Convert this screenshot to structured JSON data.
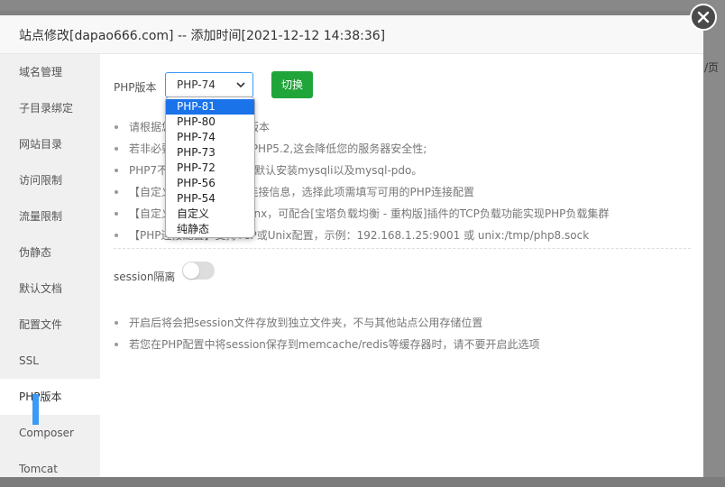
{
  "background": {
    "page_suffix": "/页"
  },
  "dialog": {
    "title": "站点修改[dapao666.com] -- 添加时间[2021-12-12 14:38:36]"
  },
  "sidebar": {
    "items": [
      {
        "label": "域名管理"
      },
      {
        "label": "子目录绑定"
      },
      {
        "label": "网站目录"
      },
      {
        "label": "访问限制"
      },
      {
        "label": "流量限制"
      },
      {
        "label": "伪静态"
      },
      {
        "label": "默认文档"
      },
      {
        "label": "配置文件"
      },
      {
        "label": "SSL"
      },
      {
        "label": "PHP版本"
      },
      {
        "label": "Composer"
      },
      {
        "label": "Tomcat"
      }
    ],
    "active_index": 9
  },
  "php": {
    "label": "PHP版本",
    "selected": "PHP-74",
    "switch_label": "切换",
    "options": [
      "PHP-81",
      "PHP-80",
      "PHP-74",
      "PHP-73",
      "PHP-72",
      "PHP-56",
      "PHP-54",
      "自定义",
      "纯静态"
    ],
    "highlighted_option": "PHP-81"
  },
  "notes": [
    "请根据您的程序需求选择版本",
    "若非必要,请尽量不要使用PHP5.2,这会降低您的服务器安全性;",
    "PHP7不支持mysql扩展，默认安装mysqli以及mysql-pdo。",
    "【自定义】可自定义PHP连接信息，选择此项需填写可用的PHP连接配置",
    "【自定义】当前仅支持nginx，可配合[宝塔负载均衡 - 重构版]插件的TCP负载功能实现PHP负载集群",
    "【PHP连接配置】支持TCP或Unix配置，示例：192.168.1.25:9001 或 unix:/tmp/php8.sock"
  ],
  "session": {
    "label": "session隔离",
    "enabled": false,
    "notes": [
      "开启后将会把session文件存放到独立文件夹，不与其他站点公用存储位置",
      "若您在PHP配置中将session保存到memcache/redis等缓存器时，请不要开启此选项"
    ]
  },
  "colors": {
    "accent_blue": "#3b9af5",
    "switch_green": "#20a53a",
    "option_highlight": "#1a73e8"
  },
  "icons": {
    "close": "close-icon",
    "select_arrow": "chevron-down-icon"
  }
}
